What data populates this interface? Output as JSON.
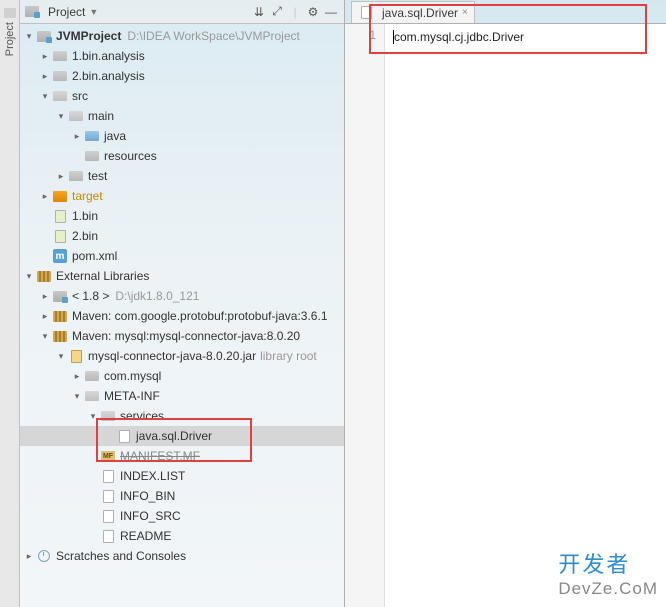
{
  "sidebar": {
    "vertical_tab": "Project"
  },
  "panel": {
    "title": "Project",
    "tools": {
      "expand": "⇊",
      "collapse": "⤢",
      "sep": "|",
      "gear": "⚙",
      "hide": "—"
    }
  },
  "tree": {
    "root": {
      "name": "JVMProject",
      "path": "D:\\IDEA WorkSpace\\JVMProject"
    },
    "bin_analysis_1": "1.bin.analysis",
    "bin_analysis_2": "2.bin.analysis",
    "src": "src",
    "main": "main",
    "java": "java",
    "resources": "resources",
    "test": "test",
    "target": "target",
    "bin1": "1.bin",
    "bin2": "2.bin",
    "pom": "pom.xml",
    "ext_lib": "External Libraries",
    "jdk": {
      "prefix": "< 1.8 >",
      "path": "D:\\jdk1.8.0_121"
    },
    "maven_protobuf": "Maven: com.google.protobuf:protobuf-java:3.6.1",
    "maven_mysql": "Maven: mysql:mysql-connector-java:8.0.20",
    "mysql_jar": {
      "name": "mysql-connector-java-8.0.20.jar",
      "suffix": "library root"
    },
    "com_mysql": "com.mysql",
    "meta_inf": "META-INF",
    "services": "services",
    "driver_file": "java.sql.Driver",
    "manifest": "MANIFEST.MF",
    "index_list": "INDEX.LIST",
    "info_bin": "INFO_BIN",
    "info_src": "INFO_SRC",
    "readme": "README",
    "scratches": "Scratches and Consoles"
  },
  "editor": {
    "tab": "java.sql.Driver",
    "line_number": "1",
    "content": "com.mysql.cj.jdbc.Driver"
  },
  "watermark": {
    "cn": "开发者",
    "en": "DevZe.CoM"
  }
}
